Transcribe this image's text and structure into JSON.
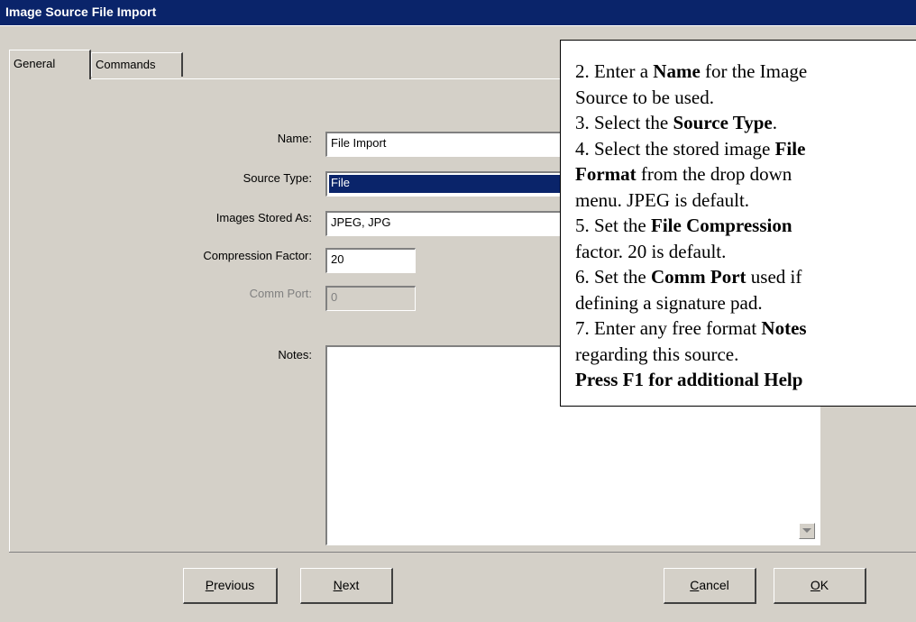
{
  "window": {
    "title": "Image Source File Import"
  },
  "tabs": [
    {
      "label": "General",
      "active": true
    },
    {
      "label": "Commands",
      "active": false
    }
  ],
  "form": {
    "name": {
      "label": "Name:",
      "value": "File Import"
    },
    "source_type": {
      "label": "Source Type:",
      "value": "File"
    },
    "images_stored_as": {
      "label": "Images Stored As:",
      "value": "JPEG, JPG"
    },
    "compression_factor": {
      "label": "Compression Factor:",
      "value": "20"
    },
    "comm_port": {
      "label": "Comm Port:",
      "value": "0",
      "disabled": true
    },
    "notes": {
      "label": "Notes:",
      "value": ""
    }
  },
  "buttons": {
    "previous": {
      "mnemonic": "P",
      "rest": "revious"
    },
    "next": {
      "mnemonic": "N",
      "rest": "ext"
    },
    "cancel": {
      "mnemonic": "C",
      "rest": "ancel"
    },
    "ok": {
      "mnemonic": "O",
      "rest": "K"
    }
  },
  "help_overlay": {
    "lines": [
      [
        {
          "t": "2. Enter a "
        },
        {
          "t": "Name",
          "b": true
        },
        {
          "t": " for the Image"
        }
      ],
      [
        {
          "t": "Source to be used."
        }
      ],
      [
        {
          "t": "3. Select the "
        },
        {
          "t": "Source Type",
          "b": true
        },
        {
          "t": "."
        }
      ],
      [
        {
          "t": "4. Select the stored image "
        },
        {
          "t": "File",
          "b": true
        }
      ],
      [
        {
          "t": "Format",
          "b": true
        },
        {
          "t": " from the drop down"
        }
      ],
      [
        {
          "t": "menu. JPEG is default."
        }
      ],
      [
        {
          "t": "5. Set the "
        },
        {
          "t": "File Compression",
          "b": true
        }
      ],
      [
        {
          "t": "factor. 20 is default."
        }
      ],
      [
        {
          "t": "6. Set the "
        },
        {
          "t": "Comm Port",
          "b": true
        },
        {
          "t": " used if"
        }
      ],
      [
        {
          "t": "defining a signature pad."
        }
      ],
      [
        {
          "t": "7. Enter any free format "
        },
        {
          "t": "Notes",
          "b": true
        }
      ],
      [
        {
          "t": "regarding this source."
        }
      ],
      [
        {
          "t": "Press F1 for additional Help",
          "b": true
        }
      ]
    ]
  }
}
